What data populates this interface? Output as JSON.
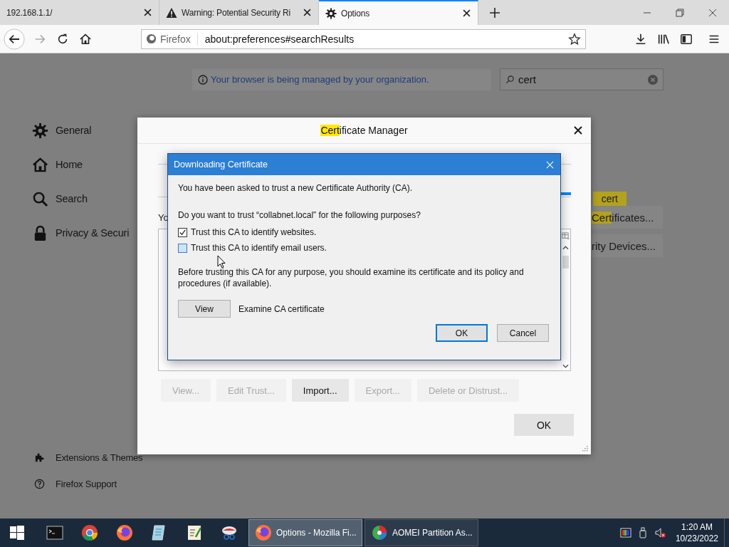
{
  "browser": {
    "tabs": [
      {
        "title": "192.168.1.1/",
        "kind": "plain",
        "selected": false
      },
      {
        "title": "Warning: Potential Security Ri",
        "kind": "warning",
        "selected": false
      },
      {
        "title": "Options",
        "kind": "settings",
        "selected": true
      }
    ],
    "identity": "Firefox",
    "url": "about:preferences#searchResults"
  },
  "preferences": {
    "banner": "Your browser is being managed by your organization.",
    "search": {
      "value": "cert"
    },
    "sidebar": [
      {
        "label": "General",
        "kind": "gear"
      },
      {
        "label": "Home",
        "kind": "home"
      },
      {
        "label": "Search",
        "kind": "search"
      },
      {
        "label": "Privacy & Securi",
        "kind": "lock"
      }
    ],
    "footer": [
      {
        "label": "Extensions & Themes",
        "kind": "puzzle"
      },
      {
        "label": "Firefox Support",
        "kind": "help"
      }
    ],
    "match_tooltip": "cert",
    "buttons": [
      {
        "parts": [
          {
            "text": "Cert",
            "highlighted": true
          },
          {
            "text": "ificates...",
            "highlighted": false
          }
        ]
      },
      {
        "parts": [
          {
            "text": "rity Devices...",
            "highlighted": false
          }
        ]
      }
    ]
  },
  "certificate_manager": {
    "title_parts": [
      {
        "text": "Cert",
        "highlighted": true
      },
      {
        "text": "ificate Manager",
        "highlighted": false
      }
    ],
    "partial_text": "Yo",
    "buttons": [
      {
        "label": "View...",
        "disabled": true
      },
      {
        "label": "Edit Trust...",
        "disabled": true
      },
      {
        "label": "Import...",
        "disabled": false
      },
      {
        "label": "Export...",
        "disabled": true
      },
      {
        "label": "Delete or Distrust...",
        "disabled": true
      }
    ],
    "ok": "OK"
  },
  "download_dialog": {
    "title": "Downloading Certificate",
    "message": "You have been asked to trust a new Certificate Authority (CA).",
    "question": "Do you want to trust “collabnet.local” for the following purposes?",
    "options": [
      {
        "label": "Trust this CA to identify websites.",
        "checked": true
      },
      {
        "label": "Trust this CA to identify email users.",
        "checked": false
      }
    ],
    "note": "Before trusting this CA for any purpose, you should examine its certificate and its policy and procedures (if available).",
    "view_button": "View",
    "view_label": "Examine CA certificate",
    "buttons": [
      {
        "label": "OK",
        "focused": true
      },
      {
        "label": "Cancel",
        "focused": false
      }
    ]
  },
  "taskbar": {
    "pinned": [
      {
        "kind": "terminal"
      },
      {
        "kind": "chrome"
      },
      {
        "kind": "firefox"
      },
      {
        "kind": "notepad"
      },
      {
        "kind": "notes"
      },
      {
        "kind": "snip"
      }
    ],
    "tasks": [
      {
        "label": "Options - Mozilla Fi...",
        "kind": "firefox",
        "selected": true
      },
      {
        "label": "AOMEI Partition As...",
        "kind": "disk",
        "selected": false
      }
    ],
    "time": "1:20 AM",
    "date": "10/23/2022"
  }
}
